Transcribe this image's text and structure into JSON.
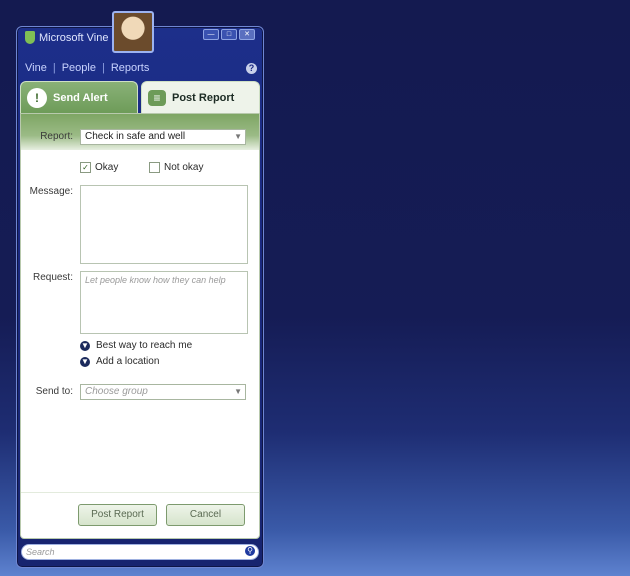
{
  "app": {
    "title": "Microsoft Vine"
  },
  "window_controls": {
    "minimize": "—",
    "maximize": "□",
    "close": "✕"
  },
  "nav": {
    "links": [
      "Vine",
      "People",
      "Reports"
    ],
    "help": "?"
  },
  "tabs": [
    {
      "label": "Send Alert",
      "icon": "alert-icon"
    },
    {
      "label": "Post Report",
      "icon": "report-icon"
    }
  ],
  "form": {
    "report_label": "Report:",
    "report_value": "Check in safe and well",
    "status_okay": "Okay",
    "status_not_okay": "Not okay",
    "okay_checked": true,
    "message_label": "Message:",
    "request_label": "Request:",
    "request_placeholder": "Let people know how they can help",
    "best_way": "Best way to reach me",
    "add_location": "Add a location",
    "send_to_label": "Send to:",
    "send_to_placeholder": "Choose group"
  },
  "buttons": {
    "post": "Post Report",
    "cancel": "Cancel"
  },
  "search": {
    "placeholder": "Search"
  }
}
